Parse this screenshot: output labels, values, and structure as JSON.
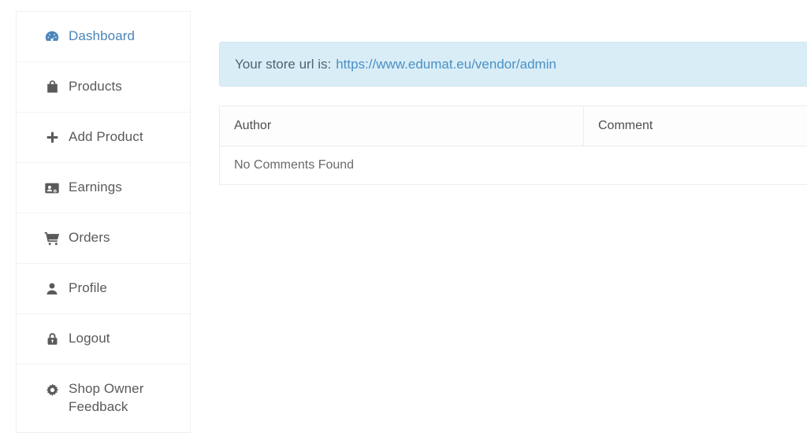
{
  "sidebar": {
    "items": [
      {
        "label": "Dashboard",
        "icon": "dashboard-icon",
        "active": true,
        "two_line": false
      },
      {
        "label": "Products",
        "icon": "shopping-bag-icon",
        "active": false,
        "two_line": false
      },
      {
        "label": "Add Product",
        "icon": "plus-icon",
        "active": false,
        "two_line": false
      },
      {
        "label": "Earnings",
        "icon": "address-card-icon",
        "active": false,
        "two_line": false
      },
      {
        "label": "Orders",
        "icon": "shopping-cart-icon",
        "active": false,
        "two_line": false
      },
      {
        "label": "Profile",
        "icon": "user-icon",
        "active": false,
        "two_line": false
      },
      {
        "label": "Logout",
        "icon": "lock-icon",
        "active": false,
        "two_line": false
      },
      {
        "label": "Shop Owner Feedback",
        "icon": "gear-icon",
        "active": false,
        "two_line": true
      }
    ]
  },
  "main": {
    "alert": {
      "prefix": "Your store url is:",
      "link_text": "https://www.edumat.eu/vendor/admin"
    },
    "comments_table": {
      "columns": [
        "Author",
        "Comment"
      ],
      "empty_message": "No Comments Found",
      "rows": []
    }
  },
  "colors": {
    "accent": "#4a85b9",
    "alert_bg": "#d9edf7",
    "alert_border": "#cfe6f2",
    "link": "#4a90c4",
    "text": "#59595c",
    "icon": "#5a5a5a",
    "table_border": "#ececec"
  }
}
